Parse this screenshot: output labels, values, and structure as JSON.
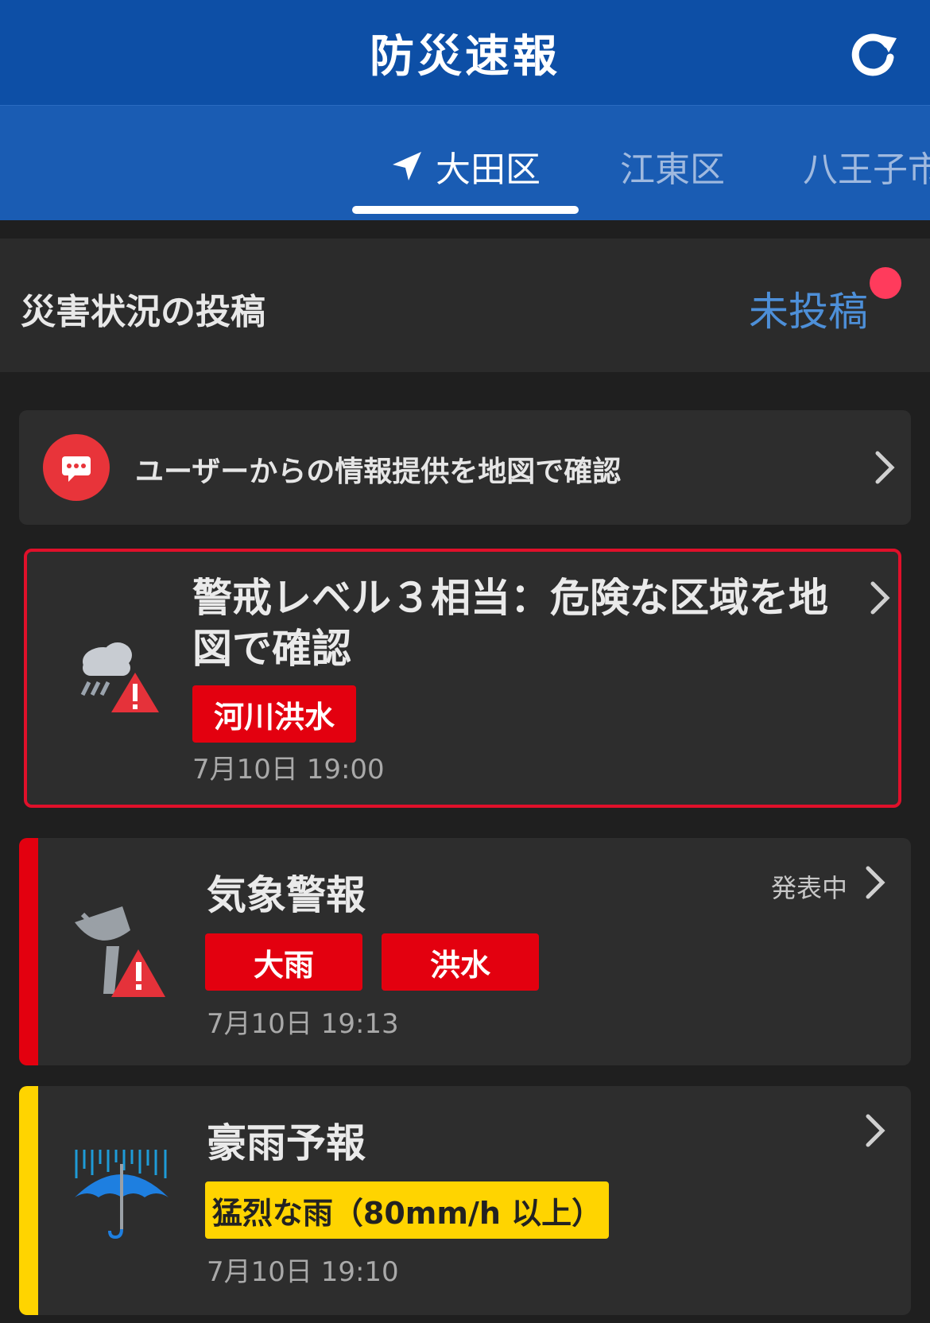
{
  "header": {
    "title": "防災速報"
  },
  "tabs": [
    {
      "label": "大田区",
      "active": true
    },
    {
      "label": "江東区",
      "active": false
    },
    {
      "label": "八王子市",
      "active": false
    }
  ],
  "post_bar": {
    "title": "災害状況の投稿",
    "status": "未投稿"
  },
  "info_card": {
    "text": "ユーザーからの情報提供を地図で確認"
  },
  "alert_card": {
    "title_line1": "警戒レベル３相当：危険な区域を地",
    "title_line2": "図で確認",
    "tag": "河川洪水",
    "time": "7月10日 19:00"
  },
  "warning_card": {
    "title": "気象警報",
    "status": "発表中",
    "tags": [
      "大雨",
      "洪水"
    ],
    "time": "7月10日 19:13"
  },
  "rain_card": {
    "title": "豪雨予報",
    "tag": "猛烈な雨（80mm/h 以上）",
    "time": "7月10日 19:10"
  },
  "colors": {
    "header_bg": "#0d4fa6",
    "tab_bg": "#1a5cb3",
    "alert_red": "#e3000f",
    "notice_yellow": "#ffd400",
    "link_blue": "#4d8fd8",
    "badge_pink": "#ff3b5c"
  }
}
